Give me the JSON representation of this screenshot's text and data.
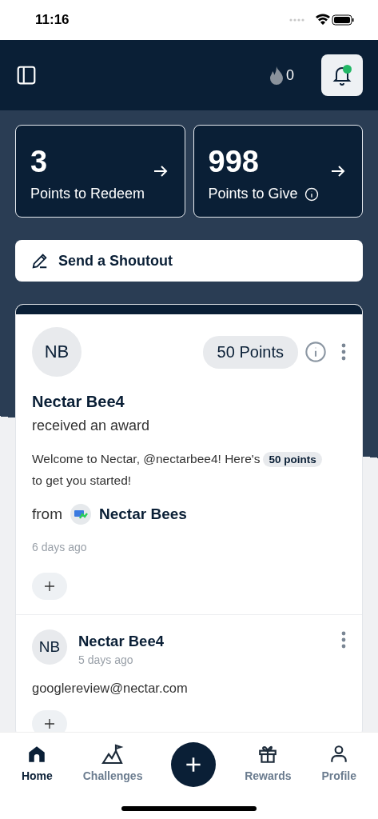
{
  "status_bar": {
    "time": "11:16"
  },
  "header": {
    "streak": "0",
    "notifications": {
      "unread": true
    }
  },
  "stats": [
    {
      "value": "3",
      "label": "Points to Redeem",
      "info": false
    },
    {
      "value": "998",
      "label": "Points to Give",
      "info": true
    }
  ],
  "shoutout_button": {
    "label": "Send a Shoutout"
  },
  "feed": [
    {
      "kind": "award",
      "initials": "NB",
      "points": "50 Points",
      "name": "Nectar Bee4",
      "action": "received an award",
      "message": "Welcome to Nectar, @nectarbee4! Here's",
      "message_badge": "50 points",
      "message_end": "to get you started!",
      "from_label": "from",
      "from_name": "Nectar Bees",
      "time": "6 days ago"
    },
    {
      "kind": "post",
      "initials": "NB",
      "name": "Nectar Bee4",
      "time": "5 days ago",
      "message": "googlereview@nectar.com"
    }
  ],
  "nav": [
    {
      "kind": "tab",
      "label": "Home",
      "selected": true
    },
    {
      "kind": "tab",
      "label": "Challenges",
      "selected": false
    },
    {
      "kind": "action"
    },
    {
      "kind": "tab",
      "label": "Rewards",
      "selected": false
    },
    {
      "kind": "tab",
      "label": "Profile",
      "selected": false
    }
  ]
}
